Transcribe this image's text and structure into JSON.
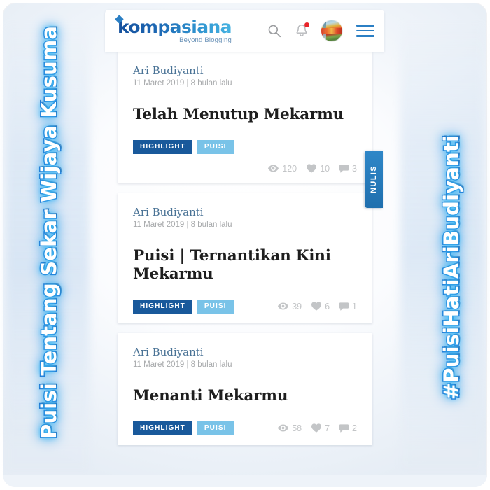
{
  "decor": {
    "left_text": "Puisi Tentang Sekar Wijaya Kusuma",
    "right_text": "#PuisiHatiAriBudiyanti",
    "outline_color": "#1f63c8",
    "glow_color": "#29b6f6",
    "fill_color": "#ffffff"
  },
  "header": {
    "logo_text": "kompasiana",
    "logo_tagline": "Beyond Blogging",
    "logo_gradient_start": "#16509c",
    "logo_gradient_end": "#46b3e2",
    "icons": {
      "search": "search-icon",
      "bell": "bell-icon",
      "notification_dot_color": "#e8242a",
      "avatar": "user-avatar",
      "menu": "hamburger-menu-icon"
    },
    "menu_color": "#2b7fc4"
  },
  "side_tab": {
    "label": "NULIS",
    "color": "#2f87c8"
  },
  "tag_colors": {
    "highlight": "#19599b",
    "puisi": "#79c3e8"
  },
  "feed": {
    "cards": [
      {
        "author": "Ari Budiyanti",
        "meta": "11 Maret 2019 | 8 bulan lalu",
        "title": "Telah Menutup Mekarmu",
        "tags": [
          "HIGHLIGHT",
          "PUISI"
        ],
        "stats": {
          "views": "120",
          "likes": "10",
          "comments": "3"
        }
      },
      {
        "author": "Ari Budiyanti",
        "meta": "11 Maret 2019 | 8 bulan lalu",
        "title": "Puisi | Ternantikan Kini Mekarmu",
        "tags": [
          "HIGHLIGHT",
          "PUISI"
        ],
        "stats": {
          "views": "39",
          "likes": "6",
          "comments": "1"
        }
      },
      {
        "author": "Ari Budiyanti",
        "meta": "11 Maret 2019 | 8 bulan lalu",
        "title": "Menanti Mekarmu",
        "tags": [
          "HIGHLIGHT",
          "PUISI"
        ],
        "stats": {
          "views": "58",
          "likes": "7",
          "comments": "2"
        }
      }
    ]
  }
}
